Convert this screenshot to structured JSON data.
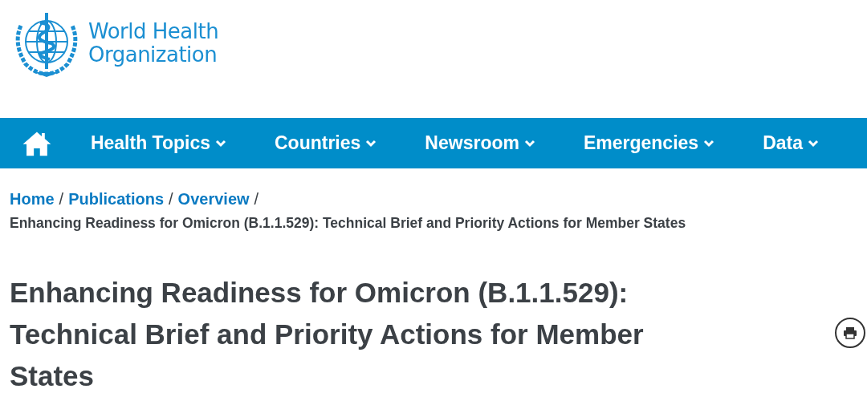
{
  "logo": {
    "lines": [
      "World Health",
      "Organization"
    ]
  },
  "nav": {
    "items": [
      {
        "label": "Health Topics",
        "has_dropdown": true
      },
      {
        "label": "Countries",
        "has_dropdown": true
      },
      {
        "label": "Newsroom",
        "has_dropdown": true
      },
      {
        "label": "Emergencies",
        "has_dropdown": true
      },
      {
        "label": "Data",
        "has_dropdown": true
      }
    ]
  },
  "breadcrumb": {
    "links": [
      {
        "label": "Home",
        "separator": "/"
      },
      {
        "label": "Publications",
        "separator": "/"
      },
      {
        "label": "Overview",
        "separator": "/"
      }
    ],
    "current": "Enhancing Readiness for Omicron (B.1.1.529): Technical Brief and Priority Actions for Member States"
  },
  "title": "Enhancing Readiness for Omicron (B.1.1.529): Technical Brief and Priority Actions for Member States"
}
